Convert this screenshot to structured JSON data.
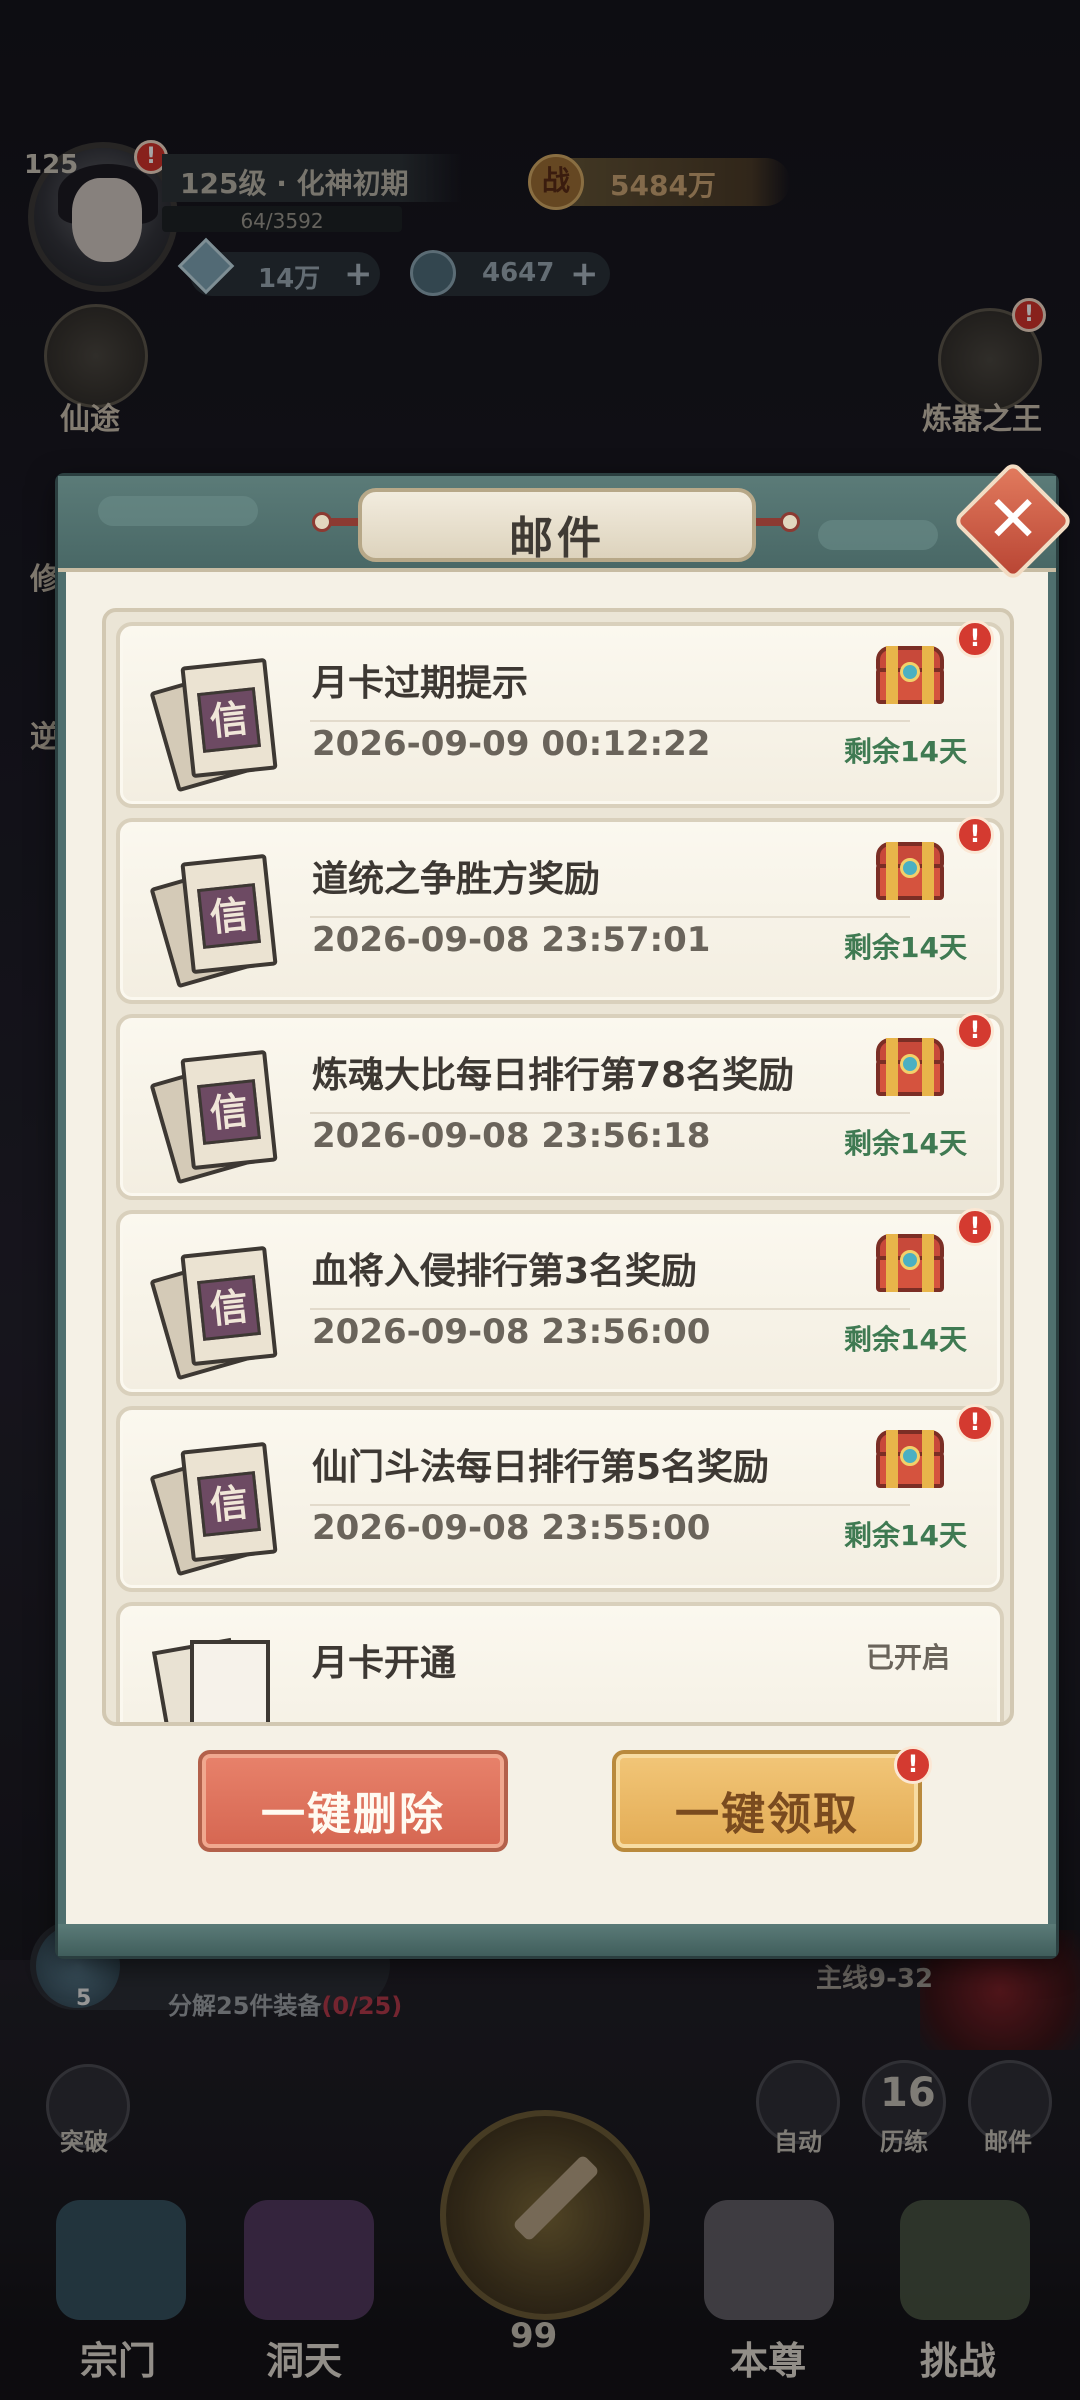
{
  "hud": {
    "level_num": "125",
    "level_label": "125级 · 化神初期",
    "exp": "64/3592",
    "power_icon": "战",
    "power": "5484万",
    "diamonds": "14万",
    "jade": "4647",
    "plus": "+",
    "badge": "!",
    "left_menu_1": "仙途",
    "left_menu_2": "修",
    "left_menu_3": "逆",
    "right_menu_1": "炼器之王"
  },
  "lower_hud": {
    "task_num": "5",
    "task_text": "分解25件装备",
    "task_progress": "(0/25)",
    "quest": "主线9-32",
    "breakthrough": "突破",
    "auto": "自动",
    "trial_num": "16",
    "trial": "历练",
    "mail": "邮件",
    "attack_count": "99",
    "nav": [
      "宗门",
      "洞天",
      "本尊",
      "挑战"
    ]
  },
  "modal": {
    "title": "邮件",
    "close_symbol": "✕",
    "seal_char": "信",
    "mails": [
      {
        "title": "月卡过期提示",
        "time": "2026-09-09 00:12:22",
        "remain": "剩余14天"
      },
      {
        "title": "道统之争胜方奖励",
        "time": "2026-09-08 23:57:01",
        "remain": "剩余14天"
      },
      {
        "title": "炼魂大比每日排行第78名奖励",
        "time": "2026-09-08 23:56:18",
        "remain": "剩余14天"
      },
      {
        "title": "血将入侵排行第3名奖励",
        "time": "2026-09-08 23:56:00",
        "remain": "剩余14天"
      },
      {
        "title": "仙门斗法每日排行第5名奖励",
        "time": "2026-09-08 23:55:00",
        "remain": "剩余14天"
      },
      {
        "title": "月卡开通",
        "status": "已开启"
      }
    ],
    "delete_all": "一键删除",
    "claim_all": "一键领取"
  },
  "colors": {
    "frame": "#4f6f6e",
    "parchment": "#f5f1e6",
    "remain_green": "#3f7a52",
    "badge_red": "#d43a30",
    "delete_btn": "#d56651",
    "claim_btn": "#e3ac55"
  }
}
